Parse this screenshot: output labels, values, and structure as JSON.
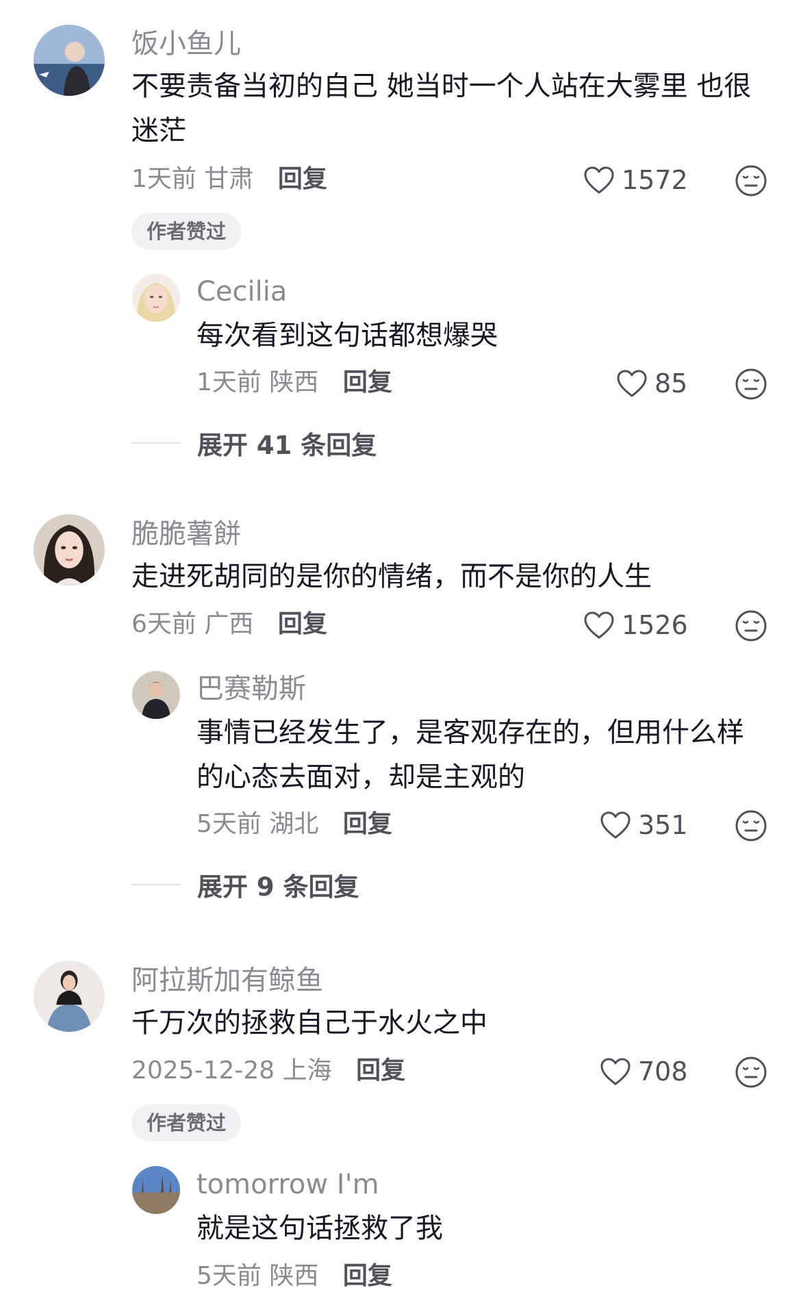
{
  "comments": [
    {
      "user": "饭小鱼儿",
      "text": "不要责备当初的自己 她当时一个人站在大雾里 也很迷茫",
      "time": "1天前",
      "location": "甘肃",
      "reply_label": "回复",
      "likes": "1572",
      "badge": "作者赞过",
      "replies": [
        {
          "user": "Cecilia",
          "text": "每次看到这句话都想爆哭",
          "time": "1天前",
          "location": "陕西",
          "reply_label": "回复",
          "likes": "85"
        }
      ],
      "expand_label": "展开 41 条回复"
    },
    {
      "user": "脆脆薯餅",
      "text": "走进死胡同的是你的情绪，而不是你的人生",
      "time": "6天前",
      "location": "广西",
      "reply_label": "回复",
      "likes": "1526",
      "replies": [
        {
          "user": "巴赛勒斯",
          "text": "事情已经发生了，是客观存在的，但用什么样的心态去面对，却是主观的",
          "time": "5天前",
          "location": "湖北",
          "reply_label": "回复",
          "likes": "351"
        }
      ],
      "expand_label": "展开 9 条回复"
    },
    {
      "user": "阿拉斯加有鲸鱼",
      "text": "千万次的拯救自己于水火之中",
      "time": "2025-12-28",
      "location": "上海",
      "reply_label": "回复",
      "likes": "708",
      "badge": "作者赞过",
      "replies": [
        {
          "user": "tomorrow I'm",
          "text": "就是这句话拯救了我",
          "time": "5天前",
          "location": "陕西",
          "reply_label": "回复"
        }
      ]
    }
  ],
  "icons": {
    "like": "heart-outline-icon",
    "dislike": "neutral-face-icon"
  },
  "colors": {
    "name": "#8a8b91",
    "text": "#161823",
    "meta": "#8a8b91",
    "reply_action": "#505159",
    "badge_bg": "#f1f1f3"
  }
}
